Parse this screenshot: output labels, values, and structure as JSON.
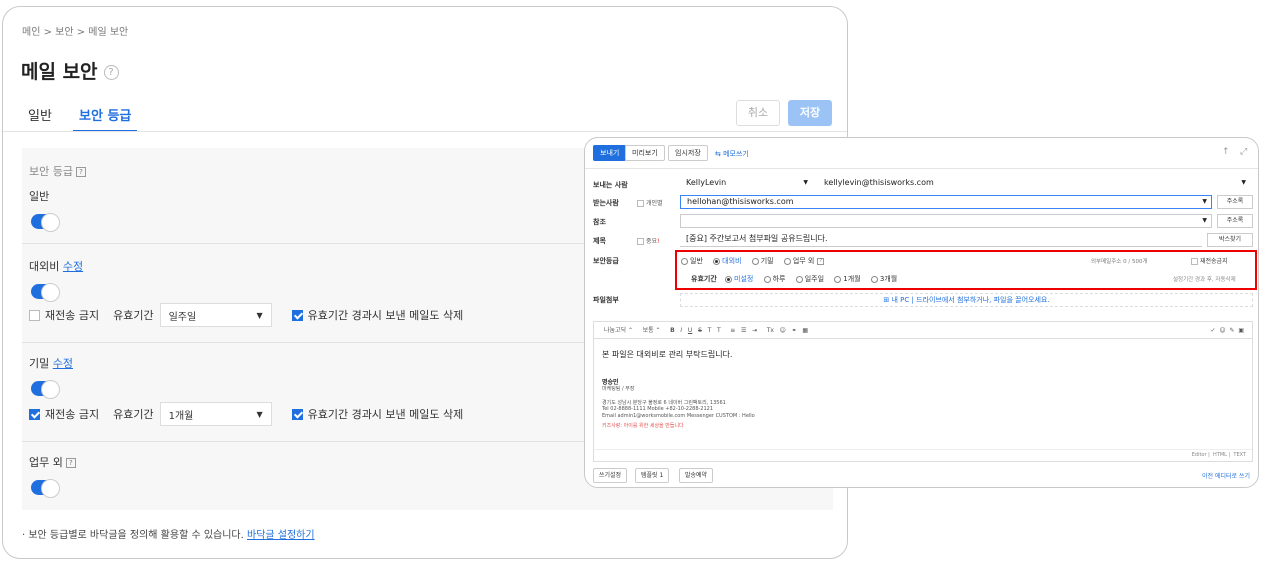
{
  "breadcrumb": "메인 > 보안 > 메일 보안",
  "page_title": "메일 보안",
  "tabs": [
    "일반",
    "보안 등급"
  ],
  "buttons": {
    "cancel": "취소",
    "save": "저장"
  },
  "levels": {
    "heading": "보안 등급",
    "normal": {
      "label": "일반"
    },
    "external": {
      "label": "대외비",
      "edit": "수정",
      "no_forward": "재전송 금지",
      "period_label": "유효기간",
      "period_value": "일주일",
      "delete_sent": "유효기간 경과시 보낸 메일도 삭제"
    },
    "secret": {
      "label": "기밀",
      "edit": "수정",
      "no_forward": "재전송 금지",
      "period_label": "유효기간",
      "period_value": "1개월",
      "delete_sent": "유효기간 경과시 보낸 메일도 삭제"
    },
    "outside": {
      "label": "업무 외"
    }
  },
  "footnote": "· 보안 등급별로 바닥글을 정의해 활용할 수 있습니다.",
  "footnote_link": "바닥글 설정하기",
  "compose": {
    "toolbar": [
      "보내기",
      "미리보기",
      "임시저장",
      "메모쓰기"
    ],
    "sender_label": "보내는 사람",
    "sender_name": "KellyLevin",
    "sender_email": "kellylevin@thisisworks.com",
    "to_label": "받는사람",
    "to_individual": "개인별",
    "to_value": "hellohan@thisisworks.com",
    "addr_book": "주소록",
    "cc_label": "참조",
    "subject_label": "제목",
    "important": "중요",
    "subject_value": "[중요] 주간보고서 첨부파일 공유드립니다.",
    "signature_btn": "박스찾기",
    "security_label": "보안등급",
    "security_options": [
      "일반",
      "대외비",
      "기밀",
      "업무 외"
    ],
    "external_limit": "외부메일주소 0 / 500개",
    "no_forward": "재전송금지",
    "period_label": "유효기간",
    "period_options": [
      "미설정",
      "하루",
      "일주일",
      "1개월",
      "3개월"
    ],
    "period_note": "설정기간 경과 후, 자동삭제",
    "attach_label": "파일첨부",
    "attach_hint": "내 PC | 드라이브에서 첨부하거나, 파일을 끌어오세요.",
    "body_text": "본 파일은 대외비로 관리 부탁드립니다.",
    "sig_name": "명승민",
    "sig_title": "마케팅팀 / 부장",
    "sig_addr": "경기도 성남시 분당구 불정로 6 네이버 그린팩토리, 13561",
    "sig_tel": "Tel 02-8888-1111 Mobile +82-10-2288-2121",
    "sig_email": "Email admin1@worksmobile.com Messenger CUSTOM : Hello",
    "sig_note": "키즈사랑: 아이를 위한 세상을 만듭니다",
    "editor_modes": [
      "Editor",
      "HTML",
      "TEXT"
    ],
    "footer": [
      "쓰기설정",
      "템플릿 1",
      "발송예약"
    ],
    "footer_right": "이전 에디터로 쓰기"
  }
}
